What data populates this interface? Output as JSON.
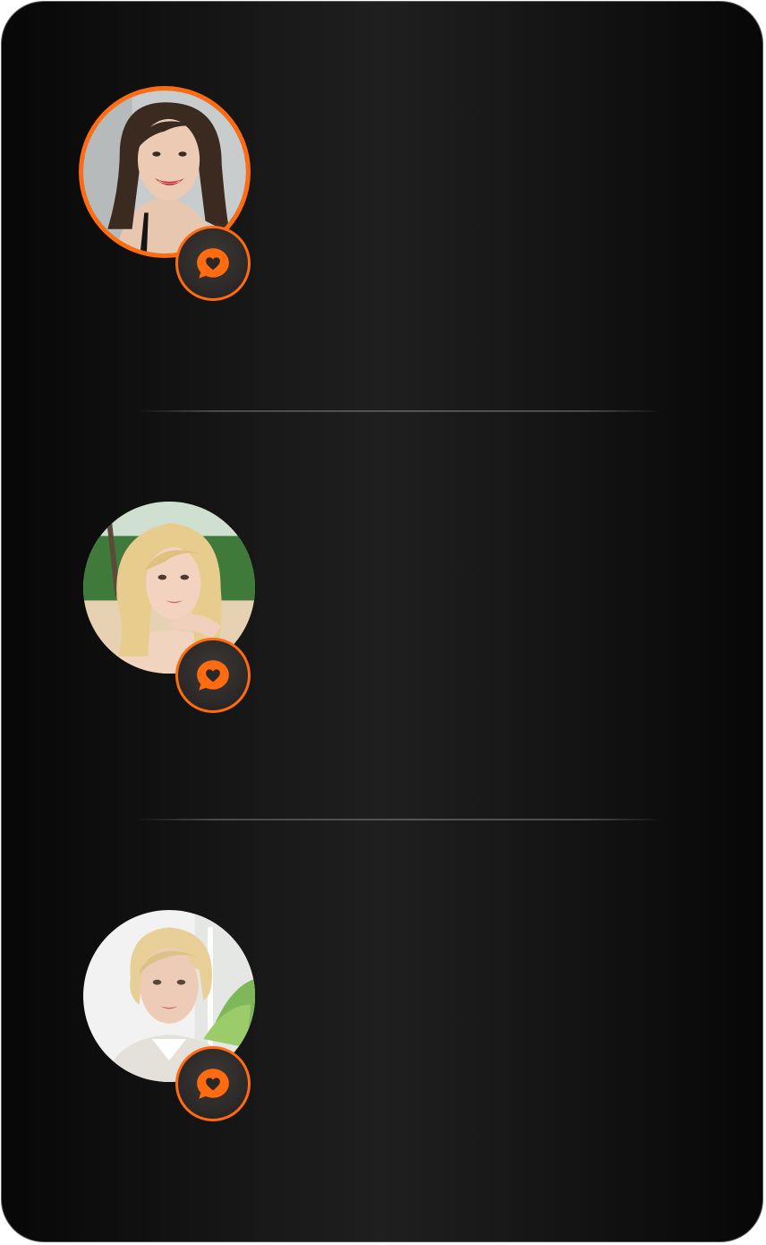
{
  "accent_color": "#ff6b10",
  "profiles": [
    {
      "avatar": "woman-brunette-smiling-photo",
      "active": true,
      "action_icon": "chat-heart-icon"
    },
    {
      "avatar": "woman-blonde-beach-photo",
      "active": false,
      "action_icon": "chat-heart-icon"
    },
    {
      "avatar": "woman-short-blonde-white-blouse-photo",
      "active": false,
      "action_icon": "chat-heart-icon"
    }
  ]
}
